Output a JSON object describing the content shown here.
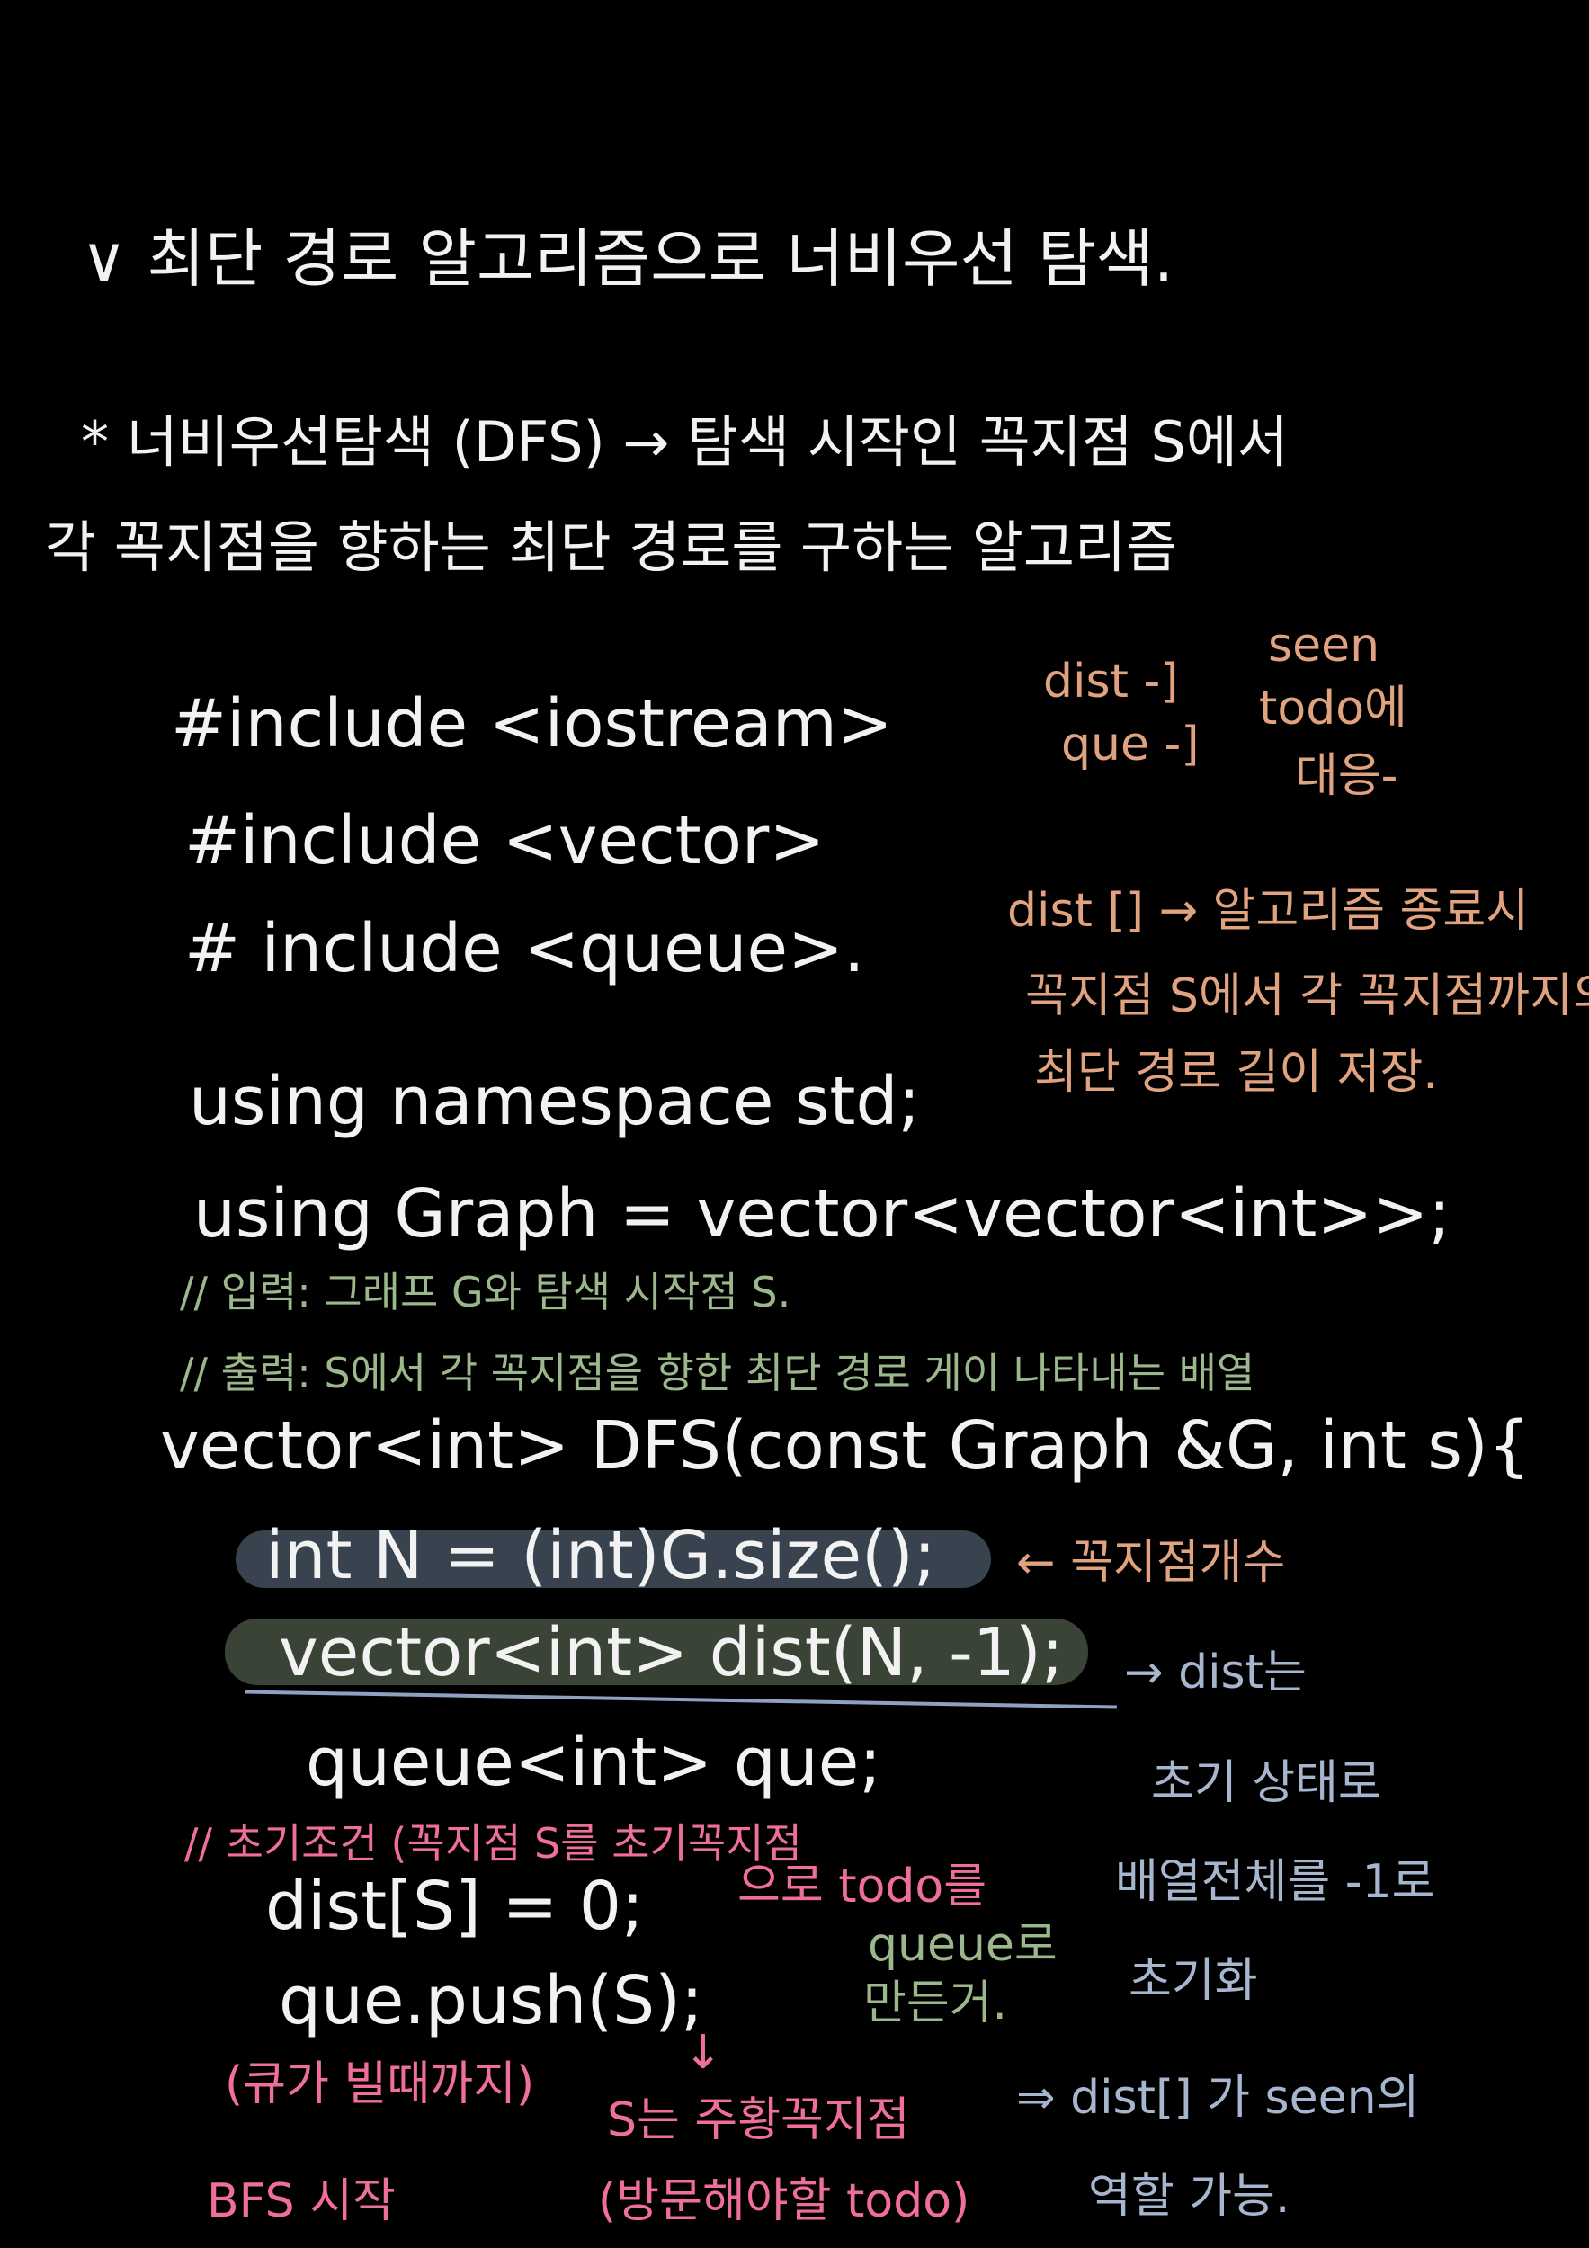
{
  "title": "∨ 최단 경로 알고리즘으로 너비우선 탐색.",
  "definition": {
    "line1": "* 너비우선탐색 (DFS) → 탐색 시작인 꼭지점 S에서",
    "line2": "각 꼭지점을 향하는 최단 경로를 구하는 알고리즘"
  },
  "code": {
    "include1": "#include <iostream>",
    "include2": "#include <vector>",
    "include3": "# include <queue>.",
    "using1": "using namespace std;",
    "using2": "using Graph = vector<vector<int>>;",
    "comment_input": "// 입력: 그래프 G와 탐색 시작점 S.",
    "comment_output": "// 출력: S에서 각 꼭지점을 향한 최단 경로 게이 나타내는 배열",
    "func": "vector<int> DFS(const Graph &G, int s){",
    "line_n": "int N = (int)G.size();",
    "line_dist": "vector<int> dist(N, -1);",
    "line_que": "queue<int> que;",
    "comment_init": "// 초기조건 (꼭지점 S를 초기꼭지점",
    "line_dist_s": "dist[S] = 0;",
    "line_push": "que.push(S);"
  },
  "notes": {
    "note_dist_que_a": "dist -]",
    "note_dist_que_b": "que -]",
    "note_seen_a": "seen",
    "note_seen_b": "todo에",
    "note_seen_c": "대응-",
    "note_dist_arr_1": "dist [] → 알고리즘 종료시",
    "note_dist_arr_2": "꼭지점 S에서 각 꼭지점까지의",
    "note_dist_arr_3": "최단 경로 길이 저장.",
    "note_vertex_count": "← 꼭지점개수",
    "note_dist_is": "→ dist는",
    "note_init_1": "초기 상태로",
    "note_init_2": "배열전체를 -1로",
    "note_init_3": "초기화",
    "note_todo_1": "으로 todo를",
    "note_todo_2": "queue로",
    "note_todo_3": "만든거.",
    "note_arrow_down": "↓",
    "note_s_active_1": "S는 주황꼭지점",
    "note_s_active_2": "(방문해야할 todo)",
    "note_seen_role_1": "⇒ dist[] 가 seen의",
    "note_seen_role_2": "역할 가능.",
    "note_left_1": "(큐가 빌때까지)",
    "note_left_2": "BFS 시작"
  }
}
